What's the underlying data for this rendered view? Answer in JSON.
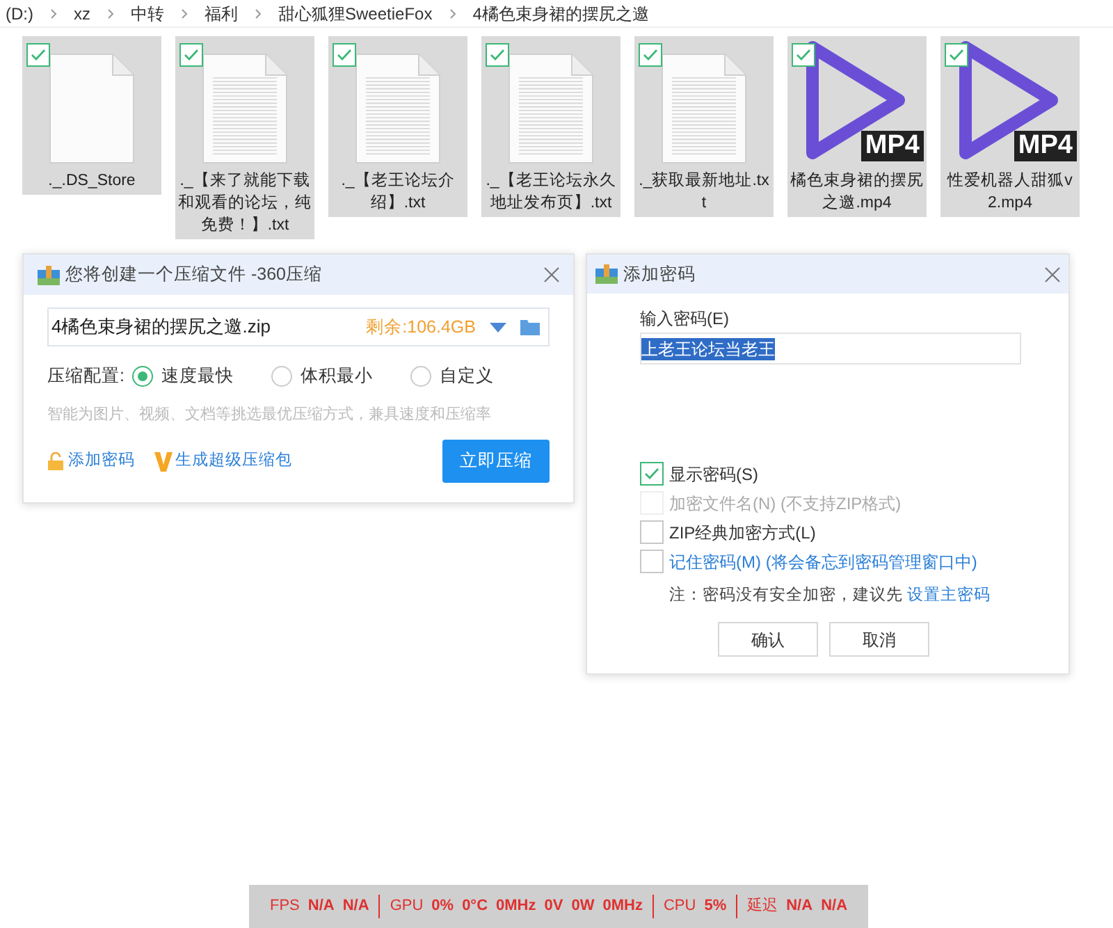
{
  "breadcrumb": [
    "(D:)",
    "xz",
    "中转",
    "福利",
    "甜心狐狸SweetieFox",
    "4橘色束身裙的摆尻之邀"
  ],
  "files": [
    {
      "name": "._.DS_Store",
      "kind": "blank",
      "checked": true
    },
    {
      "name": "._【来了就能下载和观看的论坛，纯免费！】.txt",
      "kind": "text",
      "checked": true
    },
    {
      "name": "._【老王论坛介绍】.txt",
      "kind": "text",
      "checked": true
    },
    {
      "name": "._【老王论坛永久地址发布页】.txt",
      "kind": "text",
      "checked": true
    },
    {
      "name": "._获取最新地址.txt",
      "kind": "text",
      "checked": true
    },
    {
      "name": "橘色束身裙的摆尻之邀.mp4",
      "kind": "video",
      "badge": "MP4",
      "checked": true
    },
    {
      "name": "性爱机器人甜狐v2.mp4",
      "kind": "video",
      "badge": "MP4",
      "checked": true
    }
  ],
  "compress_dialog": {
    "title": "您将创建一个压缩文件 -360压缩",
    "filename": "4橘色束身裙的摆尻之邀.zip",
    "free_space": "剩余:106.4GB",
    "config_label": "压缩配置:",
    "options": [
      {
        "label": "速度最快",
        "selected": true
      },
      {
        "label": "体积最小",
        "selected": false
      },
      {
        "label": "自定义",
        "selected": false
      }
    ],
    "hint": "智能为图片、视频、文档等挑选最优压缩方式，兼具速度和压缩率",
    "add_password": "添加密码",
    "super_pack": "生成超级压缩包",
    "compress_button": "立即压缩"
  },
  "password_dialog": {
    "title": "添加密码",
    "field_label": "输入密码(E)",
    "password": "上老王论坛当老王",
    "options": [
      {
        "label": "显示密码(S)",
        "checked": true,
        "disabled": false,
        "kind": "plain"
      },
      {
        "label": "加密文件名(N) (不支持ZIP格式)",
        "checked": false,
        "disabled": true,
        "kind": "plain"
      },
      {
        "label": "ZIP经典加密方式(L)",
        "checked": false,
        "disabled": false,
        "kind": "plain"
      },
      {
        "label": "记住密码(M) (将会备忘到密码管理窗口中)",
        "checked": false,
        "disabled": false,
        "kind": "link"
      }
    ],
    "note": "注：密码没有安全加密，建议先",
    "note_link": "设置主密码",
    "confirm": "确认",
    "cancel": "取消"
  },
  "stats": [
    {
      "label": "FPS",
      "values": [
        "N/A",
        "N/A"
      ]
    },
    {
      "label": "GPU",
      "values": [
        "0%",
        "0°C",
        "0MHz",
        "0V",
        "0W",
        "0MHz"
      ]
    },
    {
      "label": "CPU",
      "values": [
        "5%"
      ]
    },
    {
      "label": "延迟",
      "values": [
        "N/A",
        "N/A"
      ]
    }
  ]
}
